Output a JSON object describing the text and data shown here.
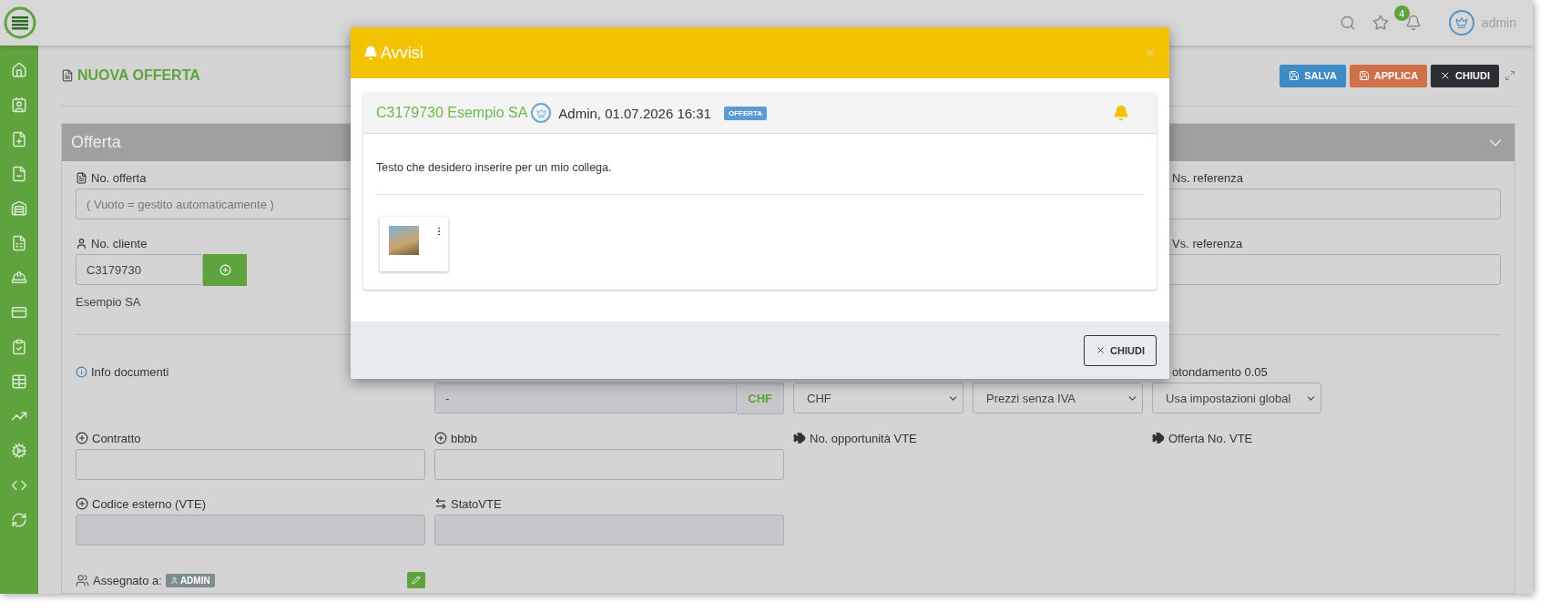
{
  "topbar": {
    "notification_count": "4",
    "user": "admin"
  },
  "page": {
    "title": "NUOVA OFFERTA",
    "buttons": [
      {
        "label": "SALVA",
        "kind": "save"
      },
      {
        "label": "APPLICA",
        "kind": "apply"
      },
      {
        "label": "CHIUDI",
        "kind": "close"
      }
    ]
  },
  "panel": {
    "title": "Offerta"
  },
  "form": {
    "no_offerta": {
      "label": "No. offerta",
      "placeholder": "( Vuoto = gestito automaticamente )"
    },
    "ns_referenza": {
      "label": "Ns. referenza"
    },
    "no_cliente": {
      "label": "No. cliente",
      "value": "C3179730",
      "customer_name": "Esempio SA"
    },
    "vs_referenza": {
      "label": "Vs. referenza"
    },
    "info_documenti": {
      "label": "Info documenti"
    },
    "amount": {
      "value": "-",
      "currency": "CHF",
      "disabled": true
    },
    "currency_select": {
      "value": "CHF"
    },
    "price_select": {
      "value": "Prezzi senza IVA"
    },
    "rounding": {
      "label": "otondamento 0.05",
      "value": "Usa impostazioni global"
    },
    "row_fields": [
      {
        "label": "Contratto",
        "kind": "plus",
        "disabled": false
      },
      {
        "label": "bbbb",
        "kind": "plus",
        "disabled": false
      },
      {
        "label": "No. opportunità VTE",
        "kind": "fish"
      },
      {
        "label": "Offerta No. VTE",
        "kind": "fish"
      }
    ],
    "ext_fields": [
      {
        "label": "Codice esterno (VTE)",
        "kind": "plus",
        "disabled": true
      },
      {
        "label": "StatoVTE",
        "kind": "sync",
        "disabled": true
      }
    ],
    "assegnato": {
      "label": "Assegnato a:",
      "user": "ADMIN"
    }
  },
  "modal": {
    "title": "Avvisi",
    "notification": {
      "customer": "C3179730 Esempio SA",
      "author": "Admin, 01.07.2026 16:31",
      "tag": "OFFERTA",
      "text": "Testo che desidero inserire per un mio collega."
    },
    "footer_button": "CHIUDI"
  }
}
